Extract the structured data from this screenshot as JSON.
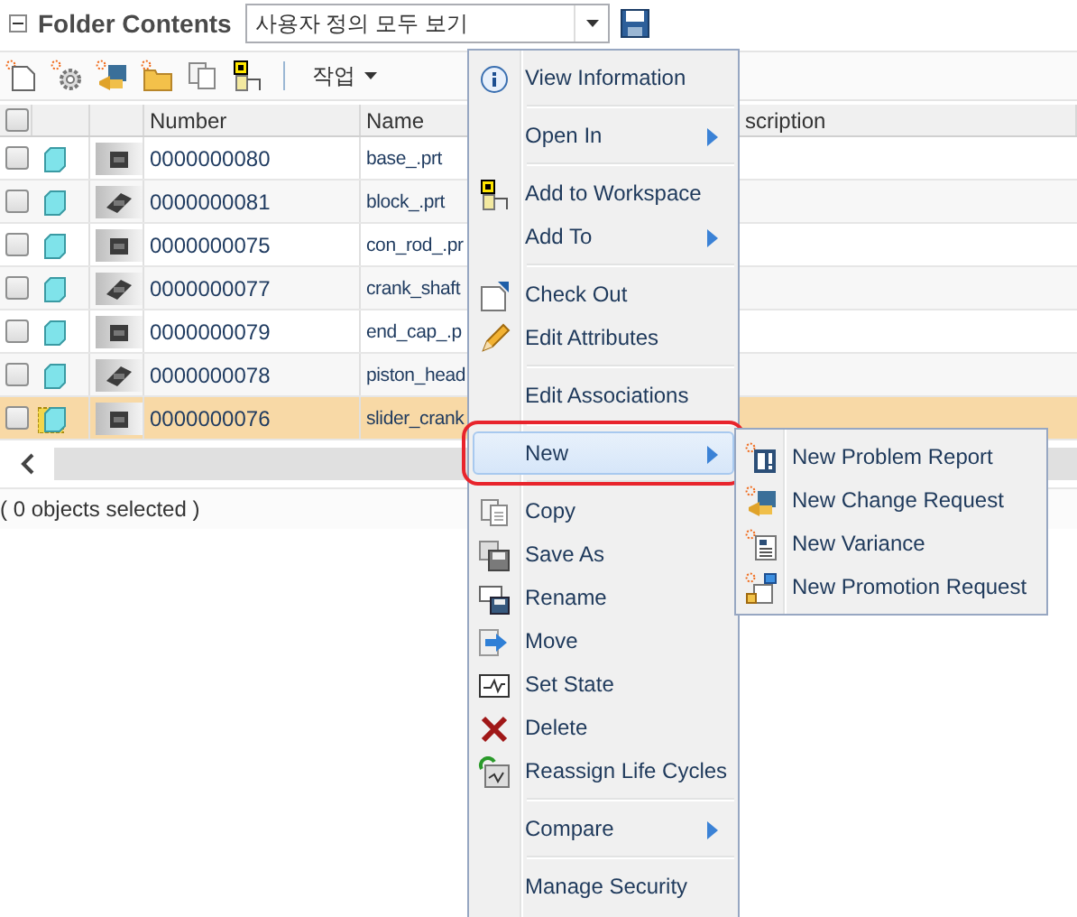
{
  "header": {
    "title": "Folder Contents",
    "view_select": {
      "value": "사용자 정의 모두 보기"
    }
  },
  "toolbar": {
    "actions_menu": "작업"
  },
  "table": {
    "select_all": {
      "checked": false
    },
    "columns": [
      "Number",
      "Name",
      "scription"
    ],
    "rows": [
      {
        "checked": false,
        "selected": false,
        "checked_out": false,
        "number": "0000000080",
        "name": "base_.prt"
      },
      {
        "checked": false,
        "selected": false,
        "checked_out": false,
        "number": "0000000081",
        "name": "block_.prt"
      },
      {
        "checked": false,
        "selected": false,
        "checked_out": false,
        "number": "0000000075",
        "name": "con_rod_.pr"
      },
      {
        "checked": false,
        "selected": false,
        "checked_out": false,
        "number": "0000000077",
        "name": "crank_shaft"
      },
      {
        "checked": false,
        "selected": false,
        "checked_out": false,
        "number": "0000000079",
        "name": "end_cap_.p"
      },
      {
        "checked": false,
        "selected": false,
        "checked_out": false,
        "number": "0000000078",
        "name": "piston_head"
      },
      {
        "checked": false,
        "selected": true,
        "checked_out": true,
        "number": "0000000076",
        "name": "slider_crank"
      }
    ]
  },
  "status_bar": "( 0 objects selected )",
  "context_menu": {
    "groups": [
      {
        "items": [
          {
            "label": "View Information",
            "submenu": false,
            "selected": false
          }
        ]
      },
      {
        "items": [
          {
            "label": "Open In",
            "submenu": true,
            "selected": false
          }
        ]
      },
      {
        "items": [
          {
            "label": "Add to Workspace",
            "submenu": false,
            "selected": false
          },
          {
            "label": "Add To",
            "submenu": true,
            "selected": false
          }
        ]
      },
      {
        "items": [
          {
            "label": "Check Out",
            "submenu": false,
            "selected": false
          },
          {
            "label": "Edit Attributes",
            "submenu": false,
            "selected": false
          }
        ]
      },
      {
        "items": [
          {
            "label": "Edit Associations",
            "submenu": false,
            "selected": false
          }
        ]
      },
      {
        "items": [
          {
            "label": "New",
            "submenu": true,
            "selected": true
          }
        ]
      },
      {
        "items": [
          {
            "label": "Copy",
            "submenu": false,
            "selected": false
          },
          {
            "label": "Save As",
            "submenu": false,
            "selected": false
          },
          {
            "label": "Rename",
            "submenu": false,
            "selected": false
          },
          {
            "label": "Move",
            "submenu": false,
            "selected": false
          },
          {
            "label": "Set State",
            "submenu": false,
            "selected": false
          },
          {
            "label": "Delete",
            "submenu": false,
            "selected": false
          },
          {
            "label": "Reassign Life Cycles",
            "submenu": false,
            "selected": false
          }
        ]
      },
      {
        "items": [
          {
            "label": "Compare",
            "submenu": true,
            "selected": false
          }
        ]
      },
      {
        "items": [
          {
            "label": "Manage Security",
            "submenu": false,
            "selected": false
          }
        ]
      }
    ]
  },
  "submenu": {
    "items": [
      "New Problem Report",
      "New Change Request",
      "New Variance",
      "New Promotion Request"
    ]
  }
}
